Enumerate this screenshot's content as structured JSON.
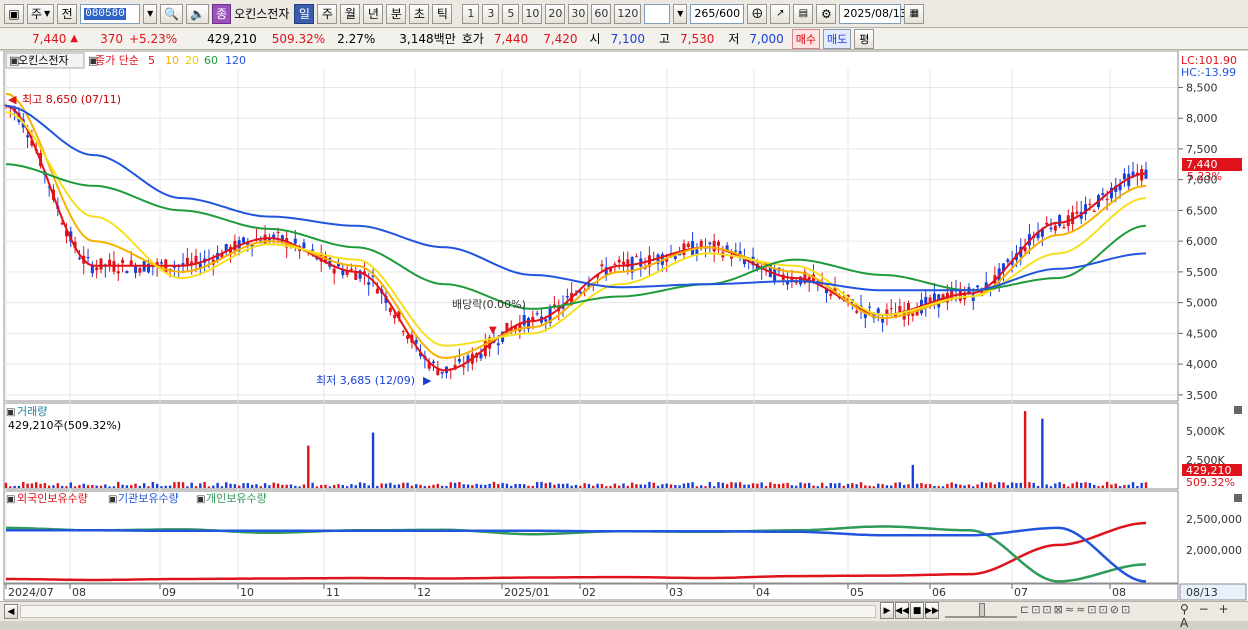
{
  "toolbar": {
    "market_sel": "주",
    "prev_label": "전",
    "code": "080580",
    "stock_name": "오킨스전자",
    "periods": [
      "일",
      "주",
      "월",
      "년",
      "분",
      "초",
      "틱"
    ],
    "active_period": "일",
    "intervals": [
      "1",
      "3",
      "5",
      "10",
      "20",
      "30",
      "60",
      "120"
    ],
    "count": "265",
    "count_total": "/600",
    "date": "2025/08/13",
    "purple_label": "종"
  },
  "quote": {
    "price": "7,440",
    "arrow": "▲",
    "change": "370",
    "change_pct": "+5.23%",
    "volume": "429,210",
    "vol_pct": "509.32%",
    "turnover": "2.27%",
    "amount": "3,148백만",
    "bid_label": "호가",
    "ask1": "7,440",
    "bid1": "7,420",
    "open_label": "시",
    "open": "7,100",
    "high_label": "고",
    "high": "7,530",
    "low_label": "저",
    "low": "7,000",
    "buy_button": "매수",
    "sell_button": "매도",
    "eval_button": "평"
  },
  "price_panel": {
    "name_tab": "오킨스전자",
    "ma_title": "종가 단순",
    "ma_periods": [
      {
        "label": "5",
        "color": "#e0121b"
      },
      {
        "label": "10",
        "color": "#f7b200"
      },
      {
        "label": "20",
        "color": "#f5e020"
      },
      {
        "label": "60",
        "color": "#1f9b3a"
      },
      {
        "label": "120",
        "color": "#2255dd"
      }
    ],
    "lc": "LC:101.90",
    "hc": "HC:-13.99",
    "high_note": "최고 8,650 (07/11)",
    "low_note": "최저 3,685 (12/09)",
    "dividend_note": "배당락(0.00%)",
    "price_tag": "7,440",
    "price_tag_pct": "5.23%",
    "y_ticks": [
      "8,500",
      "8,000",
      "7,500",
      "7,000",
      "6,500",
      "6,000",
      "5,500",
      "5,000",
      "4,500",
      "4,000",
      "3,500"
    ]
  },
  "volume_panel": {
    "title": "거래량",
    "subtitle": "429,210주(509.32%)",
    "y_ticks": [
      "5,000K",
      "2,500K"
    ],
    "tag": "429,210",
    "tag_pct": "509.32%"
  },
  "holdings_panel": {
    "series": [
      {
        "label": "외국인보유수량",
        "color": "#e0121b"
      },
      {
        "label": "기관보유수량",
        "color": "#2255dd"
      },
      {
        "label": "개인보유수량",
        "color": "#2f9a5a"
      }
    ],
    "y_ticks": [
      "2,500,000",
      "2,000,000"
    ]
  },
  "x_axis": [
    "2024/07",
    "08",
    "09",
    "10",
    "11",
    "12",
    "2025/01",
    "02",
    "03",
    "04",
    "05",
    "06",
    "07",
    "08"
  ],
  "x_axis_right": "08/13",
  "chart_data": {
    "type": "line",
    "title": "오킨스전자",
    "x": [
      "2024/07",
      "08",
      "09",
      "10",
      "11",
      "12",
      "2025/01",
      "02",
      "03",
      "04",
      "05",
      "06",
      "07",
      "08"
    ],
    "series": [
      {
        "name": "5",
        "values": [
          8200,
          5600,
          5600,
          6050,
          5500,
          3900,
          4700,
          5600,
          5900,
          5400,
          4800,
          5150,
          6300,
          7100
        ]
      },
      {
        "name": "10",
        "values": [
          8400,
          6000,
          5500,
          6000,
          5600,
          4100,
          4600,
          5500,
          5900,
          5500,
          4750,
          5100,
          6100,
          6900
        ]
      },
      {
        "name": "20",
        "values": [
          8100,
          6400,
          5400,
          5950,
          5700,
          4300,
          4500,
          5300,
          5800,
          5600,
          4800,
          5100,
          5800,
          6700
        ]
      },
      {
        "name": "60",
        "values": [
          7250,
          6900,
          6500,
          6200,
          5900,
          5300,
          4900,
          5100,
          5300,
          5700,
          5450,
          5200,
          5400,
          6250
        ]
      },
      {
        "name": "120",
        "values": [
          8200,
          7400,
          6700,
          6400,
          6250,
          5900,
          5450,
          5250,
          5300,
          5350,
          5200,
          5200,
          5550,
          5800
        ]
      }
    ],
    "ylim": [
      3400,
      8800
    ],
    "annotations": [
      "최고 8,650 (07/11)",
      "최저 3,685 (12/09)",
      "배당락(0.00%)"
    ]
  }
}
